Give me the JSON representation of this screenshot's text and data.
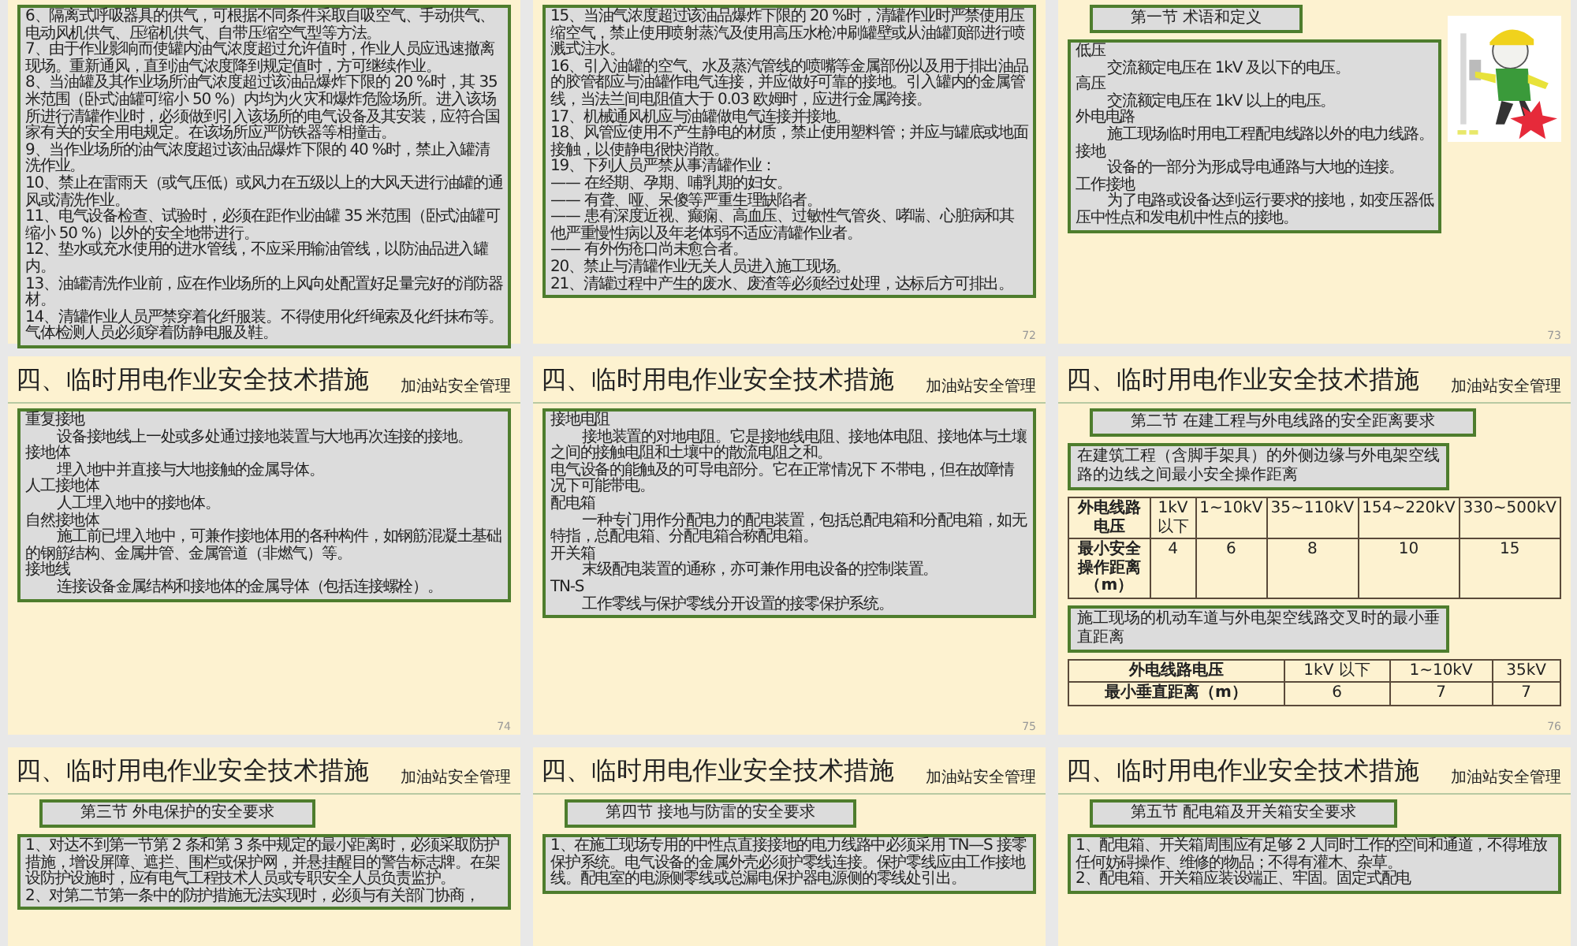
{
  "slides": [
    {
      "blocks": [
        {
          "kind": "text",
          "paragraphs": [
            {
              "text": "6、隔离式呼吸器具的供气，可根据不同条件采取自吸空气、手动供气、电动风机供气、压缩机供气、自带压缩空气型等方法。",
              "indent": false
            },
            {
              "text": "7、由于作业影响而使罐内油气浓度超过允许值时，作业人员应迅速撤离现场。重新通风，直到油气浓度降到规定值时，方可继续作业。",
              "indent": false
            },
            {
              "text": "8、当油罐及其作业场所油气浓度超过该油品爆炸下限的 20 %时，其 35 米范围（卧式油罐可缩小 50 %）内均为火灾和爆炸危险场所。进入该场所进行清罐作业时，必须做到引入该场所的电气设备及其安装，应符合国家有关的安全用电规定。在该场所应严防铁器等相撞击。",
              "indent": false
            },
            {
              "text": "9、当作业场所的油气浓度超过该油品爆炸下限的 40 %时，禁止入罐清洗作业。",
              "indent": false
            },
            {
              "text": "10、禁止在雷雨天（或气压低）或风力在五级以上的大风天进行油罐的通风或清洗作业。",
              "indent": false
            },
            {
              "text": "11、电气设备检查、试验时，必须在距作业油罐 35 米范围（卧式油罐可缩小 50 %）以外的安全地带进行。",
              "indent": false
            },
            {
              "text": "12、垫水或充水使用的进水管线，不应采用输油管线，以防油品进入罐内。",
              "indent": false
            },
            {
              "text": "13、油罐清洗作业前，应在作业场所的上风向处配置好足量完好的消防器材。",
              "indent": false
            },
            {
              "text": "14、清罐作业人员严禁穿着化纤服装。不得使用化纤绳索及化纤抹布等。气体检测人员必须穿着防静电服及鞋。",
              "indent": false
            }
          ]
        }
      ]
    },
    {
      "number": "72",
      "blocks": [
        {
          "kind": "text",
          "paragraphs": [
            {
              "text": "15、当油气浓度超过该油品爆炸下限的 20 %时，清罐作业时严禁使用压缩空气，禁止使用喷射蒸汽及使用高压水枪冲刷罐壁或从油罐顶部进行喷溅式注水。",
              "indent": false
            },
            {
              "text": "16、引入油罐的空气、水及蒸汽管线的喷嘴等金属部份以及用于排出油品的胶管都应与油罐作电气连接，并应做好可靠的接地。引入罐内的金属管线，当法兰间电阻值大于 0.03 欧姆时，应进行金属跨接。",
              "indent": false
            },
            {
              "text": "17、机械通风机应与油罐做电气连接并接地。",
              "indent": false
            },
            {
              "text": "18、风管应使用不产生静电的材质，禁止使用塑料管；并应与罐底或地面接触，以使静电很快消散。",
              "indent": false
            },
            {
              "text": "19、下列人员严禁从事清罐作业：",
              "indent": false
            },
            {
              "text": "—— 在经期、孕期、哺乳期的妇女。",
              "indent": false
            },
            {
              "text": "—— 有聋、哑、呆傻等严重生理缺陷者。",
              "indent": false
            },
            {
              "text": "—— 患有深度近视、癫痫、高血压、过敏性气管炎、哮喘、心脏病和其他严重慢性病以及年老体弱不适应清罐作业者。",
              "indent": false
            },
            {
              "text": "—— 有外伤疮口尚未愈合者。",
              "indent": false
            },
            {
              "text": "20、禁止与清罐作业无关人员进入施工现场。",
              "indent": false
            },
            {
              "text": "21、清罐过程中产生的废水、废渣等必须经过处理，达标后方可排出。",
              "indent": false
            }
          ]
        }
      ]
    },
    {
      "number": "73",
      "blocks": [
        {
          "kind": "heading",
          "text": "第一节  术语和定义"
        },
        {
          "kind": "picture"
        },
        {
          "kind": "text",
          "paragraphs": [
            {
              "text": "低压",
              "indent": false
            },
            {
              "text": "交流额定电压在 1kV 及以下的电压。",
              "indent": true
            },
            {
              "text": "高压",
              "indent": false
            },
            {
              "text": "交流额定电压在 1kV 以上的电压。",
              "indent": true
            },
            {
              "text": "外电电路",
              "indent": false
            },
            {
              "text": "施工现场临时用电工程配电线路以外的电力线路。",
              "indent": true
            },
            {
              "text": "接地",
              "indent": false
            },
            {
              "text": "设备的一部分为形成导电通路与大地的连接。",
              "indent": true
            },
            {
              "text": "工作接地",
              "indent": false
            },
            {
              "text": "为了电路或设备达到运行要求的接地，如变压器低压中性点和发电机中性点的接地。",
              "indent": true
            }
          ]
        }
      ]
    },
    {
      "title": "四、临时用电作业安全技术措施",
      "subtitle": "加油站安全管理",
      "number": "74",
      "blocks": [
        {
          "kind": "text",
          "paragraphs": [
            {
              "text": "重复接地",
              "indent": false
            },
            {
              "text": "设备接地线上一处或多处通过接地装置与大地再次连接的接地。",
              "indent": true
            },
            {
              "text": "接地体",
              "indent": false
            },
            {
              "text": "埋入地中并直接与大地接触的金属导体。",
              "indent": true
            },
            {
              "text": "人工接地体",
              "indent": false
            },
            {
              "text": "人工埋入地中的接地体。",
              "indent": true
            },
            {
              "text": "自然接地体",
              "indent": false
            },
            {
              "text": "施工前已埋入地中，可兼作接地体用的各种构件，如钢筋混凝土基础的钢筋结构、金属井管、金属管道（非燃气）等。",
              "indent": true
            },
            {
              "text": "接地线",
              "indent": false
            },
            {
              "text": "连接设备金属结构和接地体的金属导体（包括连接螺栓）。",
              "indent": true
            }
          ]
        }
      ]
    },
    {
      "title": "四、临时用电作业安全技术措施",
      "subtitle": "加油站安全管理",
      "number": "75",
      "blocks": [
        {
          "kind": "text",
          "paragraphs": [
            {
              "text": "接地电阻",
              "indent": false
            },
            {
              "text": "接地装置的对地电阻。它是接地线电阻、接地体电阻、接地体与土壤之间的接触电阻和土壤中的散流电阻之和。",
              "indent": true
            },
            {
              "text": "电气设备的能触及的可导电部分。它在正常情况下 不带电，但在故障情况下可能带电。",
              "indent": false
            },
            {
              "text": "配电箱",
              "indent": false
            },
            {
              "text": "一种专门用作分配电力的配电装置，包括总配电箱和分配电箱，如无特指，总配电箱、分配电箱合称配电箱。",
              "indent": true
            },
            {
              "text": "开关箱",
              "indent": false
            },
            {
              "text": "末级配电装置的通称，亦可兼作用电设备的控制装置。",
              "indent": true
            },
            {
              "text": "TN-S",
              "indent": false
            },
            {
              "text": "工作零线与保护零线分开设置的接零保护系统。",
              "indent": true
            }
          ]
        }
      ]
    },
    {
      "title": "四、临时用电作业安全技术措施",
      "subtitle": "加油站安全管理",
      "number": "76",
      "blocks": [
        {
          "kind": "heading",
          "text": "第二节  在建工程与外电线路的安全距离要求"
        },
        {
          "kind": "caption",
          "text": "在建筑工程（含脚手架具）的外侧边缘与外电架空线路的边线之间最小安全操作距离"
        },
        {
          "kind": "table",
          "rows": [
            [
              "外电线路电压",
              "1kV 以下",
              "1~10kV",
              "35~110kV",
              "154~220kV",
              "330~500kV"
            ],
            [
              "最小安全操作距离（m）",
              "4",
              "6",
              "8",
              "10",
              "15"
            ]
          ]
        },
        {
          "kind": "caption",
          "text": "施工现场的机动车道与外电架空线路交叉时的最小垂直距离"
        },
        {
          "kind": "table",
          "rows": [
            [
              "外电线路电压",
              "1kV 以下",
              "1~10kV",
              "35kV"
            ],
            [
              "最小垂直距离（m）",
              "6",
              "7",
              "7"
            ]
          ]
        }
      ]
    },
    {
      "title": "四、临时用电作业安全技术措施",
      "subtitle": "加油站安全管理",
      "blocks": [
        {
          "kind": "heading",
          "text": "第三节  外电保护的安全要求"
        },
        {
          "kind": "text",
          "paragraphs": [
            {
              "text": "1、对达不到第一节第 2 条和第 3 条中规定的最小距离时，必须采取防护措施，增设屏障、遮拦、围栏或保护网，并悬挂醒目的警告标志牌。在架设防护设施时，应有电气工程技术人员或专职安全人员负责监护。",
              "indent": false
            },
            {
              "text": "2、对第二节第一条中的防护措施无法实现时，必须与有关部门协商，",
              "indent": false
            }
          ]
        }
      ]
    },
    {
      "title": "四、临时用电作业安全技术措施",
      "subtitle": "加油站安全管理",
      "blocks": [
        {
          "kind": "heading",
          "text": "第四节  接地与防雷的安全要求"
        },
        {
          "kind": "text",
          "paragraphs": [
            {
              "text": "1、在施工现场专用的中性点直接接地的电力线路中必须采用 TN—S 接零保护系统。电气设备的金属外壳必须护零线连接。保护零线应由工作接地线。配电室的电源侧零线或总漏电保护器电源侧的零线处引出。",
              "indent": false
            }
          ]
        }
      ]
    },
    {
      "title": "四、临时用电作业安全技术措施",
      "subtitle": "加油站安全管理",
      "blocks": [
        {
          "kind": "heading",
          "text": "第五节  配电箱及开关箱安全要求"
        },
        {
          "kind": "text",
          "paragraphs": [
            {
              "text": "1、配电箱、开关箱周围应有足够 2 人同时工作的空间和通道，不得堆放任何妨碍操作、维修的物品；不得有灌木、杂草。",
              "indent": false
            },
            {
              "text": "2、配电箱、开关箱应装设端正、牢固。固定式配电",
              "indent": false
            }
          ]
        }
      ]
    }
  ]
}
